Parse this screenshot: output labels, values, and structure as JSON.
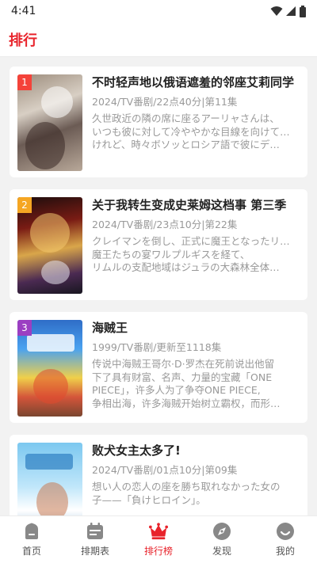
{
  "status_bar": {
    "time": "4:41"
  },
  "header": {
    "title": "排行"
  },
  "anime": [
    {
      "rank": "1",
      "rank_color": "#f4433a",
      "title": "不时轻声地以俄语遮羞的邻座艾莉同学",
      "meta": "2024/TV番剧/22点40分|第11集",
      "desc": [
        "久世政近の隣の席に座るアーリャさんは、",
        "いつも彼に対して冷ややかな目線を向けている。",
        "けれど、時々ボソッとロシア語で彼にデ…"
      ]
    },
    {
      "rank": "2",
      "rank_color": "#f5a623",
      "title": "关于我转生变成史莱姆这档事 第三季",
      "meta": "2024/TV番剧/23点10分|第22集",
      "desc": [
        "クレイマンを倒し、正式に魔王となったリムル。",
        "魔王たちの宴ワルプルギスを経て、",
        "リムルの支配地域はジュラの大森林全体…"
      ]
    },
    {
      "rank": "3",
      "rank_color": "#9b3fc2",
      "title": "海贼王",
      "meta": "1999/TV番剧/更新至1118集",
      "desc": [
        "传说中海贼王哥尔·D·罗杰在死前说出他留",
        "下了具有财富、名声、力量的宝藏「ONE",
        "PIECE」，许多人为了争夺ONE PIECE,",
        "争相出海，许多海贼开始树立霸权，而形…"
      ]
    },
    {
      "rank": "",
      "rank_color": "",
      "title": "败犬女主太多了!",
      "meta": "2024/TV番剧/01点10分|第09集",
      "desc": [
        "想い人の恋人の座を勝ち取れなかった女の",
        "子——「負けヒロイン」。"
      ]
    }
  ],
  "nav": [
    {
      "label": "首页",
      "icon": "home-icon"
    },
    {
      "label": "排期表",
      "icon": "schedule-icon"
    },
    {
      "label": "排行榜",
      "icon": "crown-icon",
      "active": true
    },
    {
      "label": "发现",
      "icon": "discover-icon"
    },
    {
      "label": "我的",
      "icon": "profile-icon"
    }
  ],
  "colors": {
    "accent": "#e8232b",
    "inactive_icon": "#888888"
  }
}
